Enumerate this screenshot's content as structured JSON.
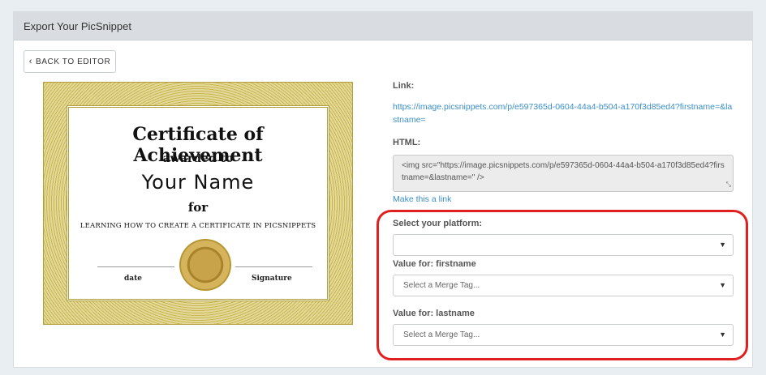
{
  "panel": {
    "title": "Export Your PicSnippet"
  },
  "toolbar": {
    "back_label": "BACK TO EDITOR"
  },
  "certificate": {
    "title": "Certificate of Achievement",
    "awarded": "awarded to",
    "name": "Your Name",
    "for": "for",
    "subtitle": "LEARNING HOW TO CREATE A CERTIFICATE IN PICSNIPPETS",
    "date_label": "date",
    "signature_label": "Signature"
  },
  "export": {
    "link_label": "Link:",
    "link_url": "https://image.picsnippets.com/p/e597365d-0604-44a4-b504-a170f3d85ed4?firstname=&lastname=",
    "html_label": "HTML:",
    "html_code": "<img src=\"https://image.picsnippets.com/p/e597365d-0604-44a4-b504-a170f3d85ed4?firstname=&lastname=\" />",
    "make_link": "Make this a link"
  },
  "merge": {
    "platform_label": "Select your platform:",
    "platform_value": "",
    "firstname_label": "Value for: firstname",
    "firstname_value": "Select a Merge Tag...",
    "lastname_label": "Value for: lastname",
    "lastname_value": "Select a Merge Tag..."
  },
  "colors": {
    "highlight": "#e02020",
    "link": "#3a8fc7",
    "gold": "#c7b64e"
  }
}
